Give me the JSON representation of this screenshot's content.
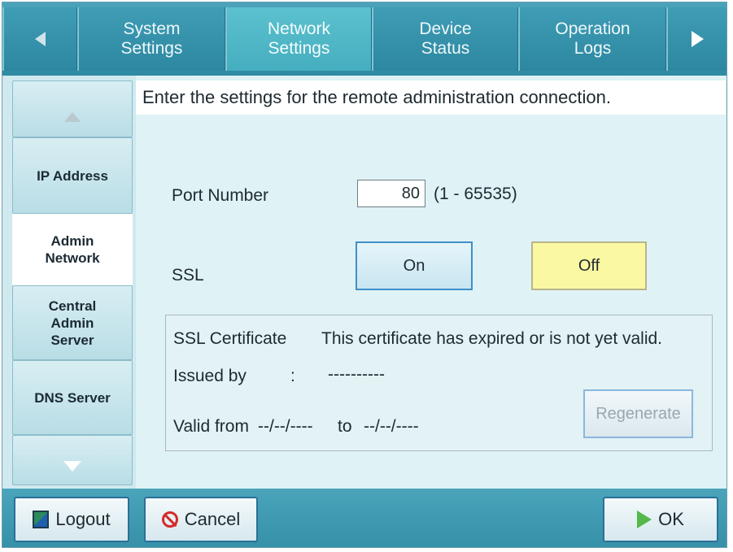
{
  "tabs": {
    "items": [
      {
        "label": "System Settings"
      },
      {
        "label": "Network Settings",
        "active": true
      },
      {
        "label": "Device Status"
      },
      {
        "label": "Operation Logs"
      }
    ],
    "prev_icon": "triangle-left-icon",
    "next_icon": "triangle-right-icon"
  },
  "sidebar": {
    "up_icon": "triangle-up-icon",
    "down_icon": "triangle-down-icon",
    "items": [
      {
        "label": "IP Address"
      },
      {
        "label": "Admin Network",
        "active": true
      },
      {
        "label": "Central Admin Server"
      },
      {
        "label": "DNS Server"
      }
    ]
  },
  "main": {
    "instruction": "Enter the settings for the remote administration connection.",
    "port": {
      "label": "Port Number",
      "value": "80",
      "range": "(1 - 65535)"
    },
    "ssl": {
      "label": "SSL",
      "on_label": "On",
      "off_label": "Off",
      "selected": "Off"
    },
    "certificate": {
      "label": "SSL Certificate",
      "status": "This certificate has expired or is not yet valid.",
      "issued_by_label": "Issued by",
      "separator": ":",
      "issued_by_value": "----------",
      "valid_from_label": "Valid from",
      "valid_from_value": "--/--/----",
      "to_label": "to",
      "valid_to_value": "--/--/----",
      "regenerate_label": "Regenerate"
    }
  },
  "footer": {
    "logout_label": "Logout",
    "cancel_label": "Cancel",
    "ok_label": "OK"
  },
  "colors": {
    "tab_bar": "#3a95ad",
    "active_tab": "#52b8c8",
    "off_button": "#fbf8a3",
    "on_button_border": "#3f8fc8",
    "panel_background": "#dff2f6"
  }
}
